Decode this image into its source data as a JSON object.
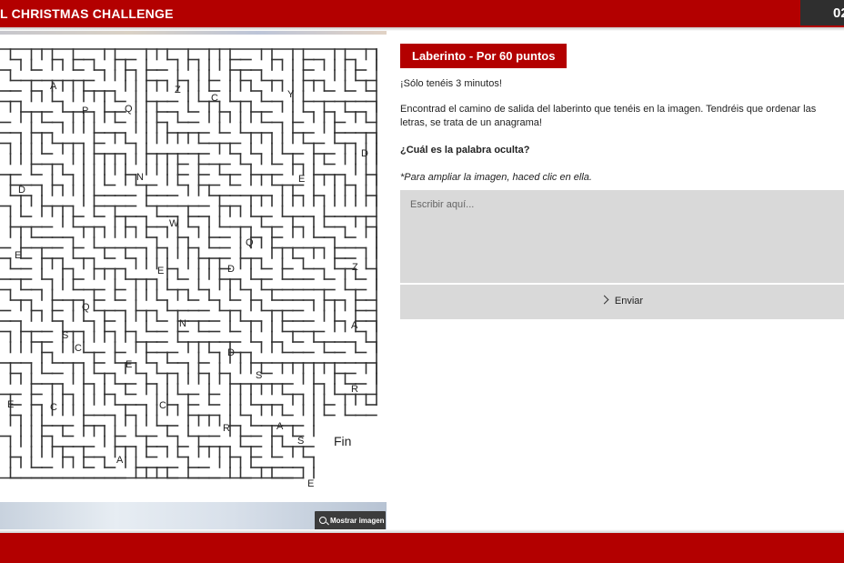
{
  "header": {
    "title": "L CHRISTMAS CHALLENGE",
    "timer": "02"
  },
  "maze": {
    "letters": [
      "A",
      "P",
      "Q",
      "Z",
      "C",
      "Y",
      "D",
      "N",
      "E",
      "D",
      "W",
      "Q",
      "E",
      "E",
      "D",
      "Z",
      "Q",
      "N",
      "A",
      "S",
      "C",
      "D",
      "E",
      "S",
      "R",
      "E",
      "C",
      "C",
      "R",
      "A",
      "S",
      "A",
      "E"
    ],
    "end_label": "Fin"
  },
  "image_button": {
    "label": "Mostrar imagen",
    "icon": "zoom-icon"
  },
  "challenge": {
    "badge": "Laberinto - Por 60 puntos",
    "time_note": "¡Sólo tenéis 3 minutos!",
    "instructions": "Encontrad el camino de salida del laberinto que tenéis en la imagen. Tendréis que ordenar las letras, se trata de un anagrama!",
    "question": "¿Cuál es la palabra oculta?",
    "hint": "*Para ampliar la imagen, haced clic en ella.",
    "answer_placeholder": "Escribir aquí...",
    "answer_value": "",
    "submit_label": "Enviar",
    "submit_icon": "chevron-right-icon"
  },
  "colors": {
    "brand_red": "#b30000",
    "panel_gray": "#d9d9d9",
    "timer_bg": "#2f2f2f"
  }
}
